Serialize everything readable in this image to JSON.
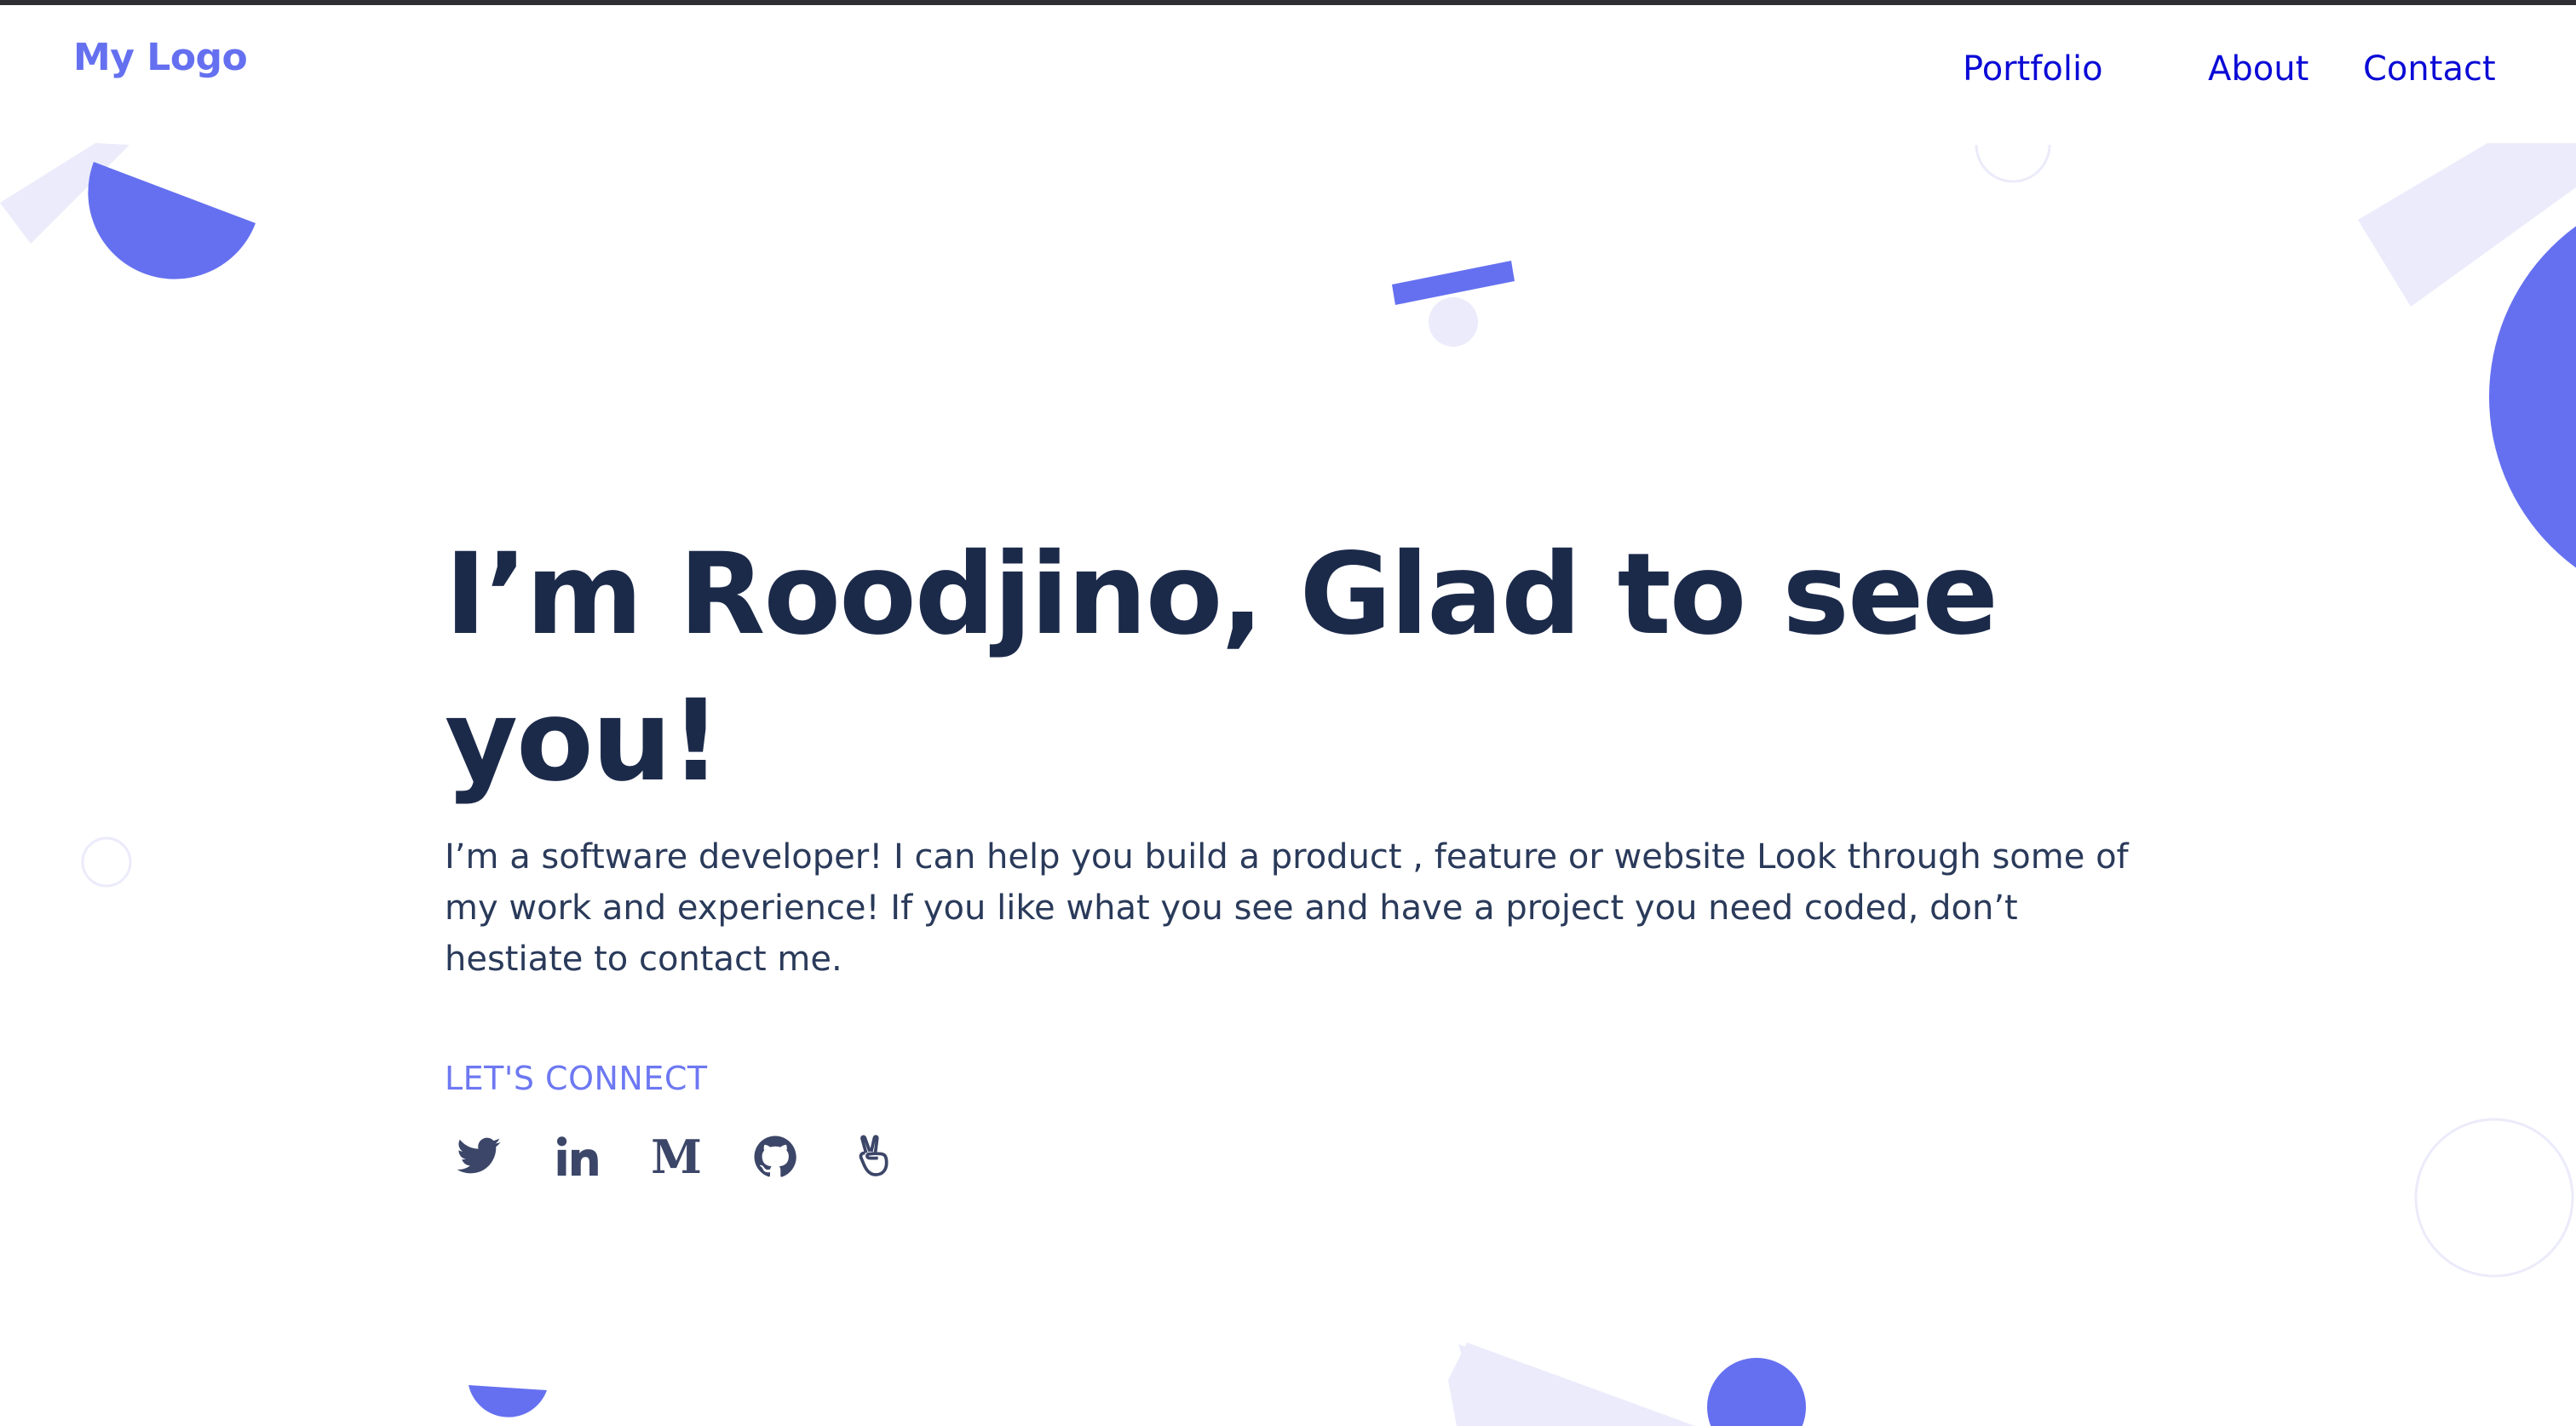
{
  "header": {
    "logo": "My Logo",
    "nav": [
      {
        "label": "Portfolio"
      },
      {
        "label": "About"
      },
      {
        "label": "Contact"
      }
    ]
  },
  "hero": {
    "heading_line1": "I’m Roodjino, Glad to see",
    "heading_line2": "you!",
    "description": "I’m a software developer! I can help you build a product , feature or website Look through some of my work and experience! If you like what you see and have a project you need coded, don’t hestiate to contact me."
  },
  "connect": {
    "label": "LET'S CONNECT",
    "socials": [
      {
        "icon": "twitter-icon"
      },
      {
        "icon": "linkedin-icon"
      },
      {
        "icon": "medium-icon"
      },
      {
        "icon": "github-icon"
      },
      {
        "icon": "angellist-icon"
      }
    ]
  },
  "colors": {
    "accent": "#6570f0",
    "nav_link": "#0b0bd6",
    "heading": "#1c2a4a",
    "body_text": "#2a3a5a",
    "icon": "#3c4668",
    "decor_light": "#ebebfb"
  }
}
